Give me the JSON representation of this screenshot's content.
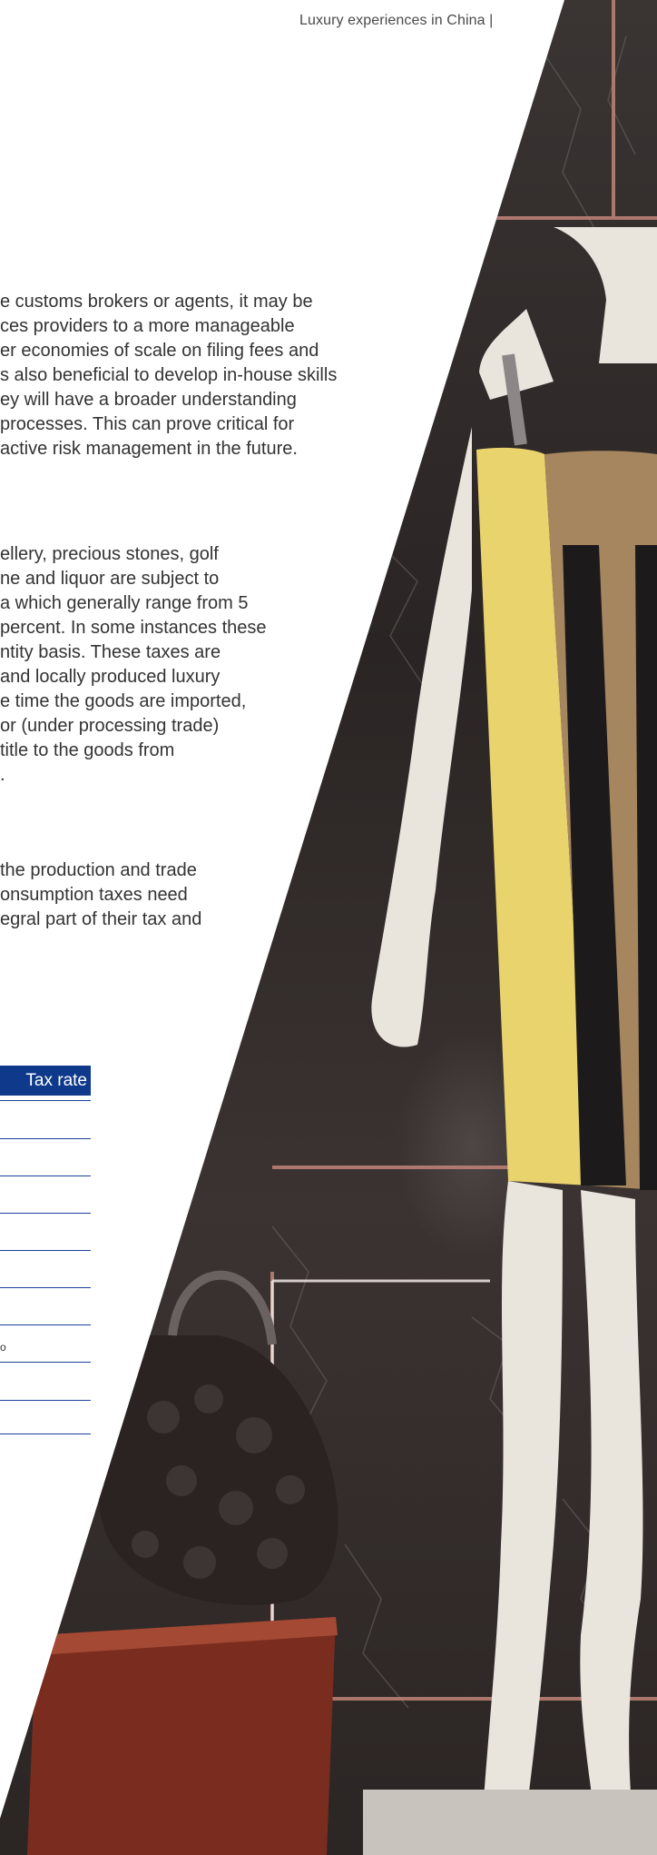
{
  "header": {
    "title": "Luxury experiences in China |"
  },
  "paragraphs": [
    {
      "lines": [
        "e customs brokers or agents, it may be",
        "ces providers to a more manageable",
        "er economies of scale on filing fees and",
        "s also beneficial to develop in-house skills",
        "ey will have a broader understanding",
        " processes. This can prove critical for",
        "active risk management in the future."
      ]
    },
    {
      "lines": [
        "ellery, precious stones, golf",
        "ne and liquor are subject to",
        "a which generally range from 5",
        "percent. In some instances these",
        "ntity basis. These taxes are",
        " and locally produced luxury",
        "e time the goods are imported,",
        "or (under processing trade)",
        " title to the goods from",
        "."
      ]
    },
    {
      "lines": [
        " the production and trade",
        "onsumption taxes need",
        "egral part of their tax and"
      ]
    }
  ],
  "table": {
    "header": "Tax rate",
    "row_count": 8,
    "partial_note": "o"
  },
  "colors": {
    "table_header_bg": "#0f3a8c",
    "table_rule": "#1d3f9a",
    "body_text": "#333333",
    "dress_yellow": "#e9d36d",
    "dress_tan": "#a6865f",
    "dress_black": "#1c1a1b"
  },
  "image": {
    "subject": "mannequin-in-striped-dress-with-handbag"
  }
}
